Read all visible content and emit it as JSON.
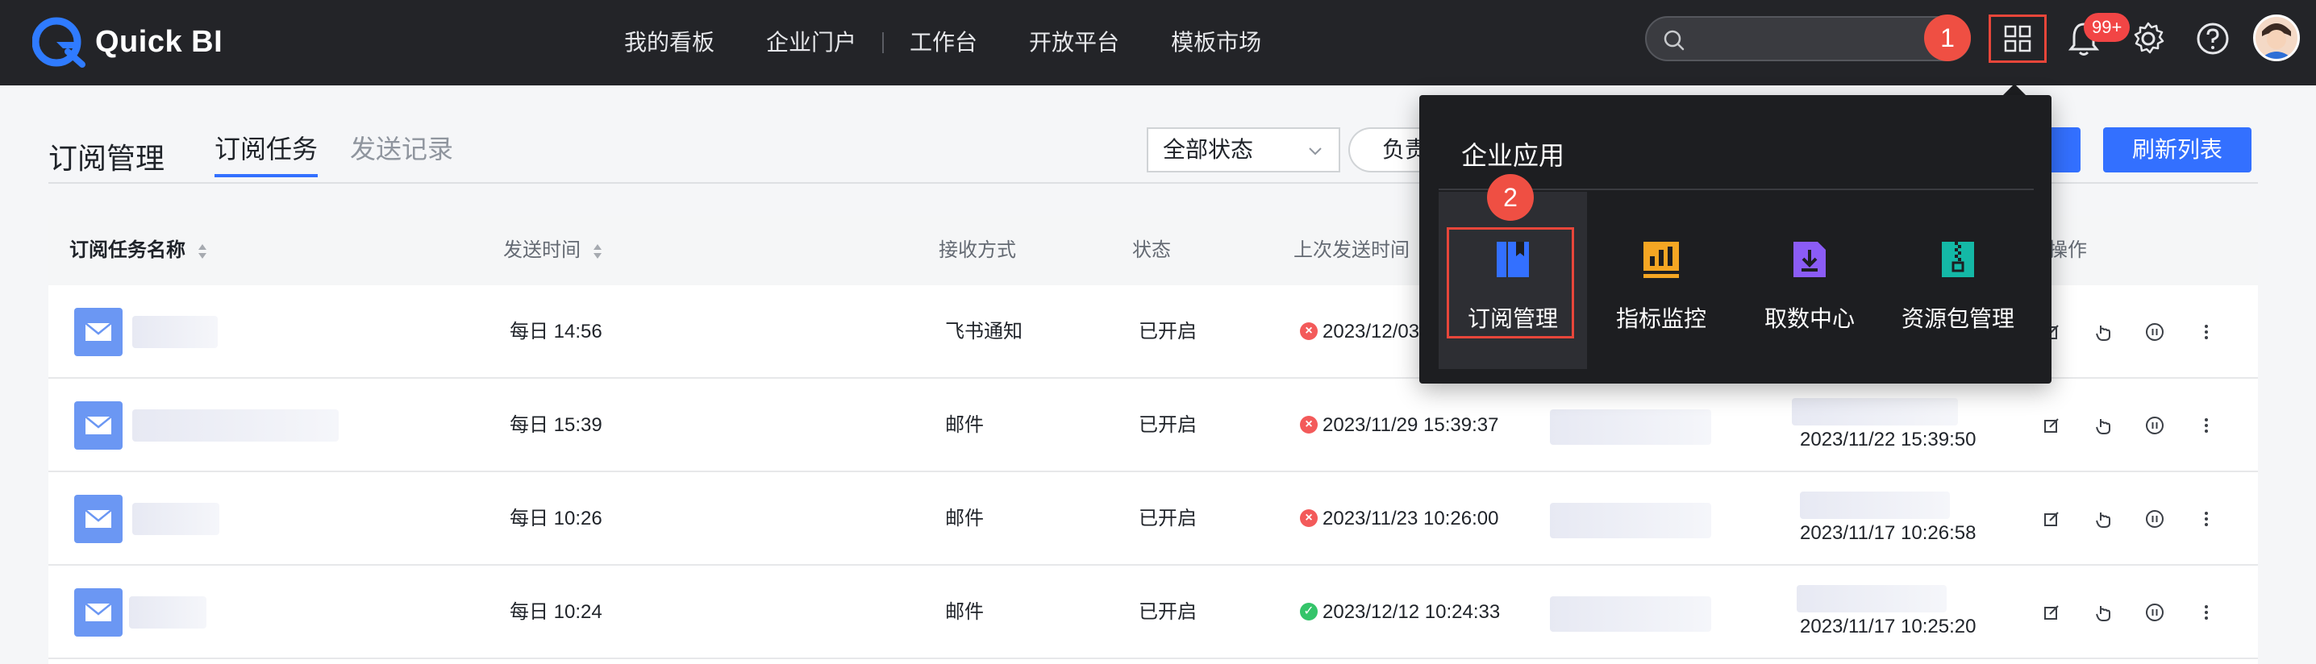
{
  "app": {
    "name": "Quick BI"
  },
  "nav": [
    "我的看板",
    "企业门户",
    "工作台",
    "开放平台",
    "模板市场"
  ],
  "header": {
    "notification_count": "99+",
    "step1": "1",
    "step2": "2"
  },
  "page": {
    "title": "订阅管理",
    "tabs": [
      "订阅任务",
      "发送记录"
    ],
    "active_tab": "订阅任务",
    "status_filter": "全部状态",
    "owner_filter": "负责",
    "refresh_label": "刷新列表"
  },
  "table": {
    "columns": [
      "订阅任务名称",
      "发送时间",
      "接收方式",
      "状态",
      "上次发送时间",
      "操作"
    ],
    "rows": [
      {
        "send_time": "每日 14:56",
        "method": "飞书通知",
        "status": "已开启",
        "last_result": "fail",
        "last_time": "2023/12/03",
        "created": ""
      },
      {
        "send_time": "每日 15:39",
        "method": "邮件",
        "status": "已开启",
        "last_result": "fail",
        "last_time": "2023/11/29 15:39:37",
        "created": "2023/11/22 15:39:50"
      },
      {
        "send_time": "每日 10:26",
        "method": "邮件",
        "status": "已开启",
        "last_result": "fail",
        "last_time": "2023/11/23 10:26:00",
        "created": "2023/11/17 10:26:58"
      },
      {
        "send_time": "每日 10:24",
        "method": "邮件",
        "status": "已开启",
        "last_result": "success",
        "last_time": "2023/12/12 10:24:33",
        "created": "2023/11/17 10:25:20"
      }
    ]
  },
  "popup": {
    "title": "企业应用",
    "apps": [
      {
        "label": "订阅管理",
        "icon": "subscription-book-icon",
        "color": "#3370ff"
      },
      {
        "label": "指标监控",
        "icon": "metric-chart-icon",
        "color": "#f5a623"
      },
      {
        "label": "取数中心",
        "icon": "data-download-icon",
        "color": "#8b5cf6"
      },
      {
        "label": "资源包管理",
        "icon": "resource-package-icon",
        "color": "#14b8a6"
      }
    ]
  }
}
